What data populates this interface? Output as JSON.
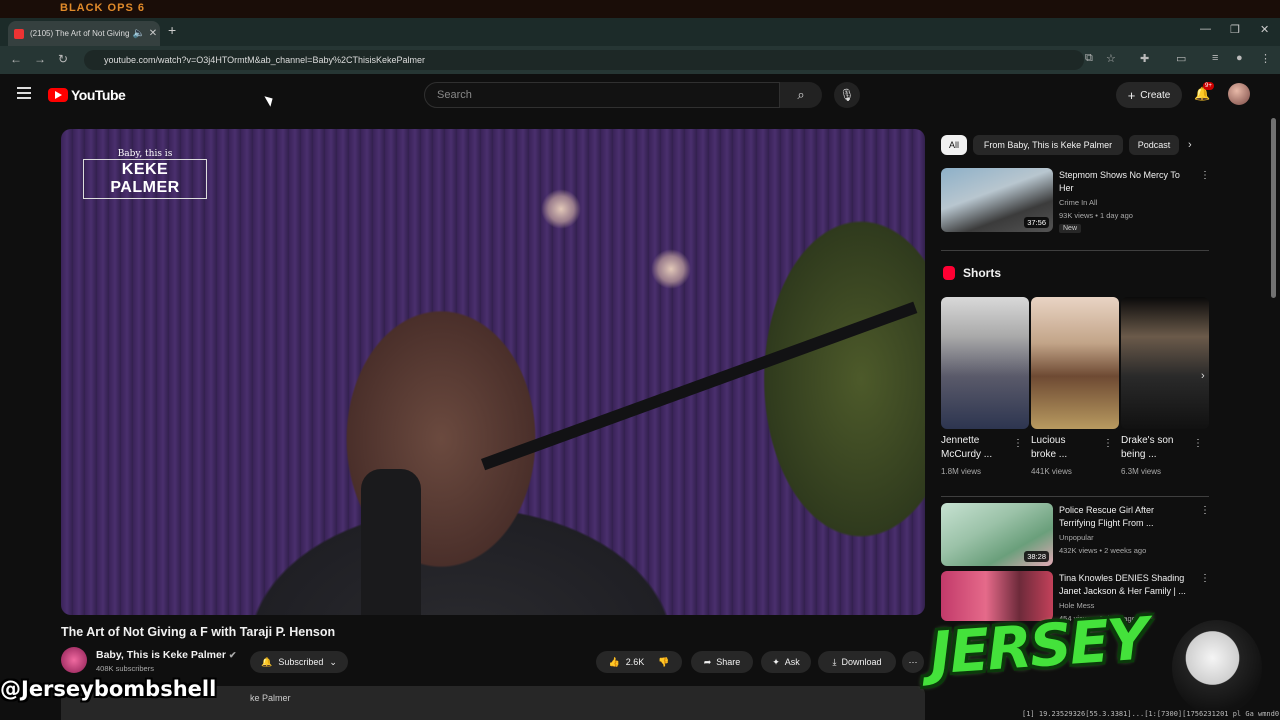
{
  "browser": {
    "top_brand": "BLACK OPS 6",
    "tab_title": "(2105) The Art of Not Giving",
    "new_tab": "+",
    "url": "youtube.com/watch?v=O3j4HTOrmtM&ab_channel=Baby%2CThisisKekePalmer"
  },
  "header": {
    "logo": "YouTube",
    "search_placeholder": "Search",
    "create_label": "Create",
    "notif_badge": "9+"
  },
  "video": {
    "logo_small": "Baby, this is",
    "logo_big": "KEKE PALMER",
    "title": "The Art of Not Giving a F with Taraji P. Henson",
    "channel": "Baby, This is Keke Palmer",
    "subscribers": "408K subscribers",
    "subscribed_label": "Subscribed",
    "likes": "2.6K",
    "share_label": "Share",
    "ask_label": "Ask",
    "download_label": "Download",
    "desc_snippet": "ke Palmer"
  },
  "sidebar": {
    "chips": [
      "All",
      "From Baby, This is Keke Palmer",
      "Podcast"
    ],
    "rec1": {
      "title_l1": "Stepmom Shows No Mercy To",
      "title_l2": "Her",
      "channel": "Crime In All",
      "meta": "93K views • 1 day ago",
      "duration": "37:56",
      "badge": "New"
    },
    "shorts_heading": "Shorts",
    "shorts": [
      {
        "t1": "Jennette",
        "t2": "McCurdy ...",
        "views": "1.8M views"
      },
      {
        "t1": "Lucious",
        "t2": "broke ...",
        "views": "441K views"
      },
      {
        "t1": "Drake's son",
        "t2": "being ...",
        "views": "6.3M views"
      }
    ],
    "rec2": {
      "title_l1": "Police Rescue Girl After",
      "title_l2": "Terrifying Flight From ...",
      "channel": "Unpopular",
      "meta": "432K views • 2 weeks ago",
      "duration": "38:28"
    },
    "rec3": {
      "title_l1": "Tina Knowles DENIES Shading",
      "title_l2": "Janet Jackson & Her Family | ...",
      "channel": "Hole Mess",
      "meta": "454 views • 2 days ago"
    }
  },
  "overlay": {
    "watermark": "@Jerseybombshell",
    "jersey": "JERSEY",
    "coords": "[1] 19.23529326[55.3.3381]...[1:[7300][1756231201 pl Ga wmnd0"
  },
  "colors": {
    "accent": "#ff0000",
    "jersey_green": "#44e23b",
    "tab_bar": "#1c2b29"
  }
}
